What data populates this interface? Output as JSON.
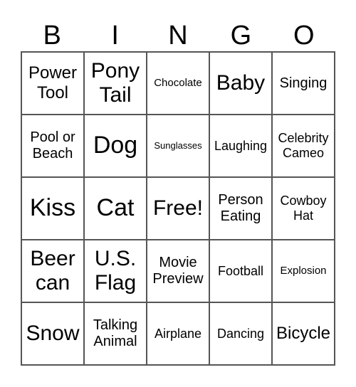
{
  "header": [
    "B",
    "I",
    "N",
    "G",
    "O"
  ],
  "cells": [
    "Power Tool",
    "Pony Tail",
    "Chocolate",
    "Baby",
    "Singing",
    "Pool or Beach",
    "Dog",
    "Sunglasses",
    "Laughing",
    "Celebrity Cameo",
    "Kiss",
    "Cat",
    "Free!",
    "Person Eating",
    "Cowboy Hat",
    "Beer can",
    "U.S. Flag",
    "Movie Preview",
    "Football",
    "Explosion",
    "Snow",
    "Talking Animal",
    "Airplane",
    "Dancing",
    "Bicycle"
  ]
}
